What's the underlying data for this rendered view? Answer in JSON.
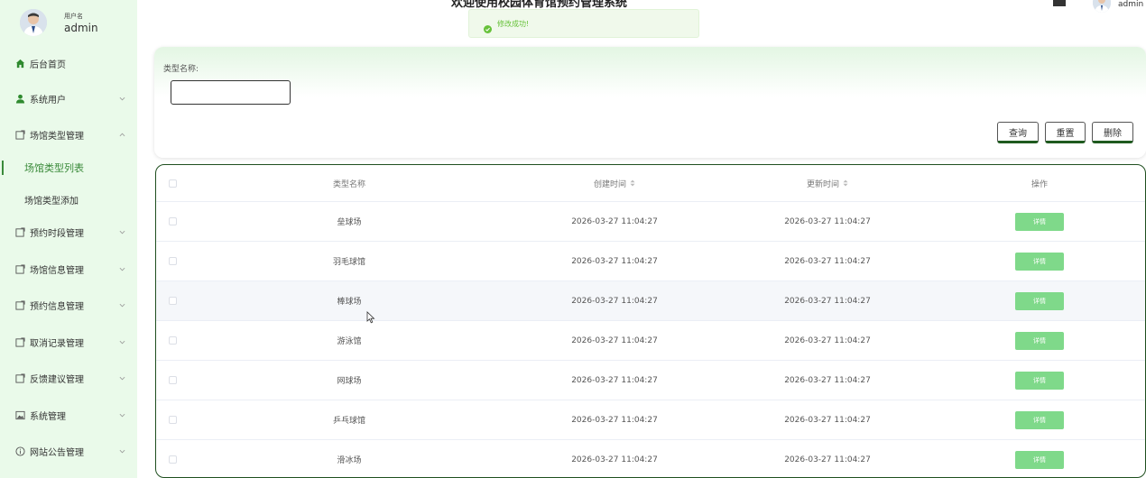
{
  "header": {
    "title": "欢迎使用校园体育馆预约管理系统",
    "username": "admin"
  },
  "toast": {
    "message": "修改成功!"
  },
  "sidebar": {
    "user_label": "用户名",
    "user_name": "admin",
    "items": [
      {
        "label": "后台首页",
        "icon": "home-icon",
        "arrow": ""
      },
      {
        "label": "系统用户",
        "icon": "user-icon",
        "arrow": "down"
      },
      {
        "label": "场馆类型管理",
        "icon": "edit-icon",
        "arrow": "up"
      },
      {
        "label": "预约时段管理",
        "icon": "edit-icon",
        "arrow": "down"
      },
      {
        "label": "场馆信息管理",
        "icon": "edit-icon",
        "arrow": "down"
      },
      {
        "label": "预约信息管理",
        "icon": "edit-icon",
        "arrow": "down"
      },
      {
        "label": "取消记录管理",
        "icon": "edit-icon",
        "arrow": "down"
      },
      {
        "label": "反馈建议管理",
        "icon": "edit-icon",
        "arrow": "down"
      },
      {
        "label": "系统管理",
        "icon": "picture-icon",
        "arrow": "down"
      },
      {
        "label": "网站公告管理",
        "icon": "info-icon",
        "arrow": "down"
      }
    ],
    "sub_items": [
      {
        "label": "场馆类型列表",
        "active": true
      },
      {
        "label": "场馆类型添加",
        "active": false
      }
    ]
  },
  "search": {
    "label": "类型名称:",
    "value": "",
    "buttons": {
      "query": "查询",
      "reset": "重置",
      "delete": "删除"
    }
  },
  "table": {
    "columns": [
      "类型名称",
      "创建时间",
      "更新时间",
      "操作"
    ],
    "detail_label": "详情",
    "rows": [
      {
        "name": "垒球场",
        "created": "2026-03-27 11:04:27",
        "updated": "2026-03-27 11:04:27"
      },
      {
        "name": "羽毛球馆",
        "created": "2026-03-27 11:04:27",
        "updated": "2026-03-27 11:04:27"
      },
      {
        "name": "棒球场",
        "created": "2026-03-27 11:04:27",
        "updated": "2026-03-27 11:04:27"
      },
      {
        "name": "游泳馆",
        "created": "2026-03-27 11:04:27",
        "updated": "2026-03-27 11:04:27"
      },
      {
        "name": "网球场",
        "created": "2026-03-27 11:04:27",
        "updated": "2026-03-27 11:04:27"
      },
      {
        "name": "乒乓球馆",
        "created": "2026-03-27 11:04:27",
        "updated": "2026-03-27 11:04:27"
      },
      {
        "name": "滑冰场",
        "created": "2026-03-27 11:04:27",
        "updated": "2026-03-27 11:04:27"
      }
    ]
  },
  "colors": {
    "accent": "#3a8a3a",
    "sidebar_bg": "#eafaea",
    "detail_button": "#7fd98a",
    "toast_text": "#67c23a"
  }
}
